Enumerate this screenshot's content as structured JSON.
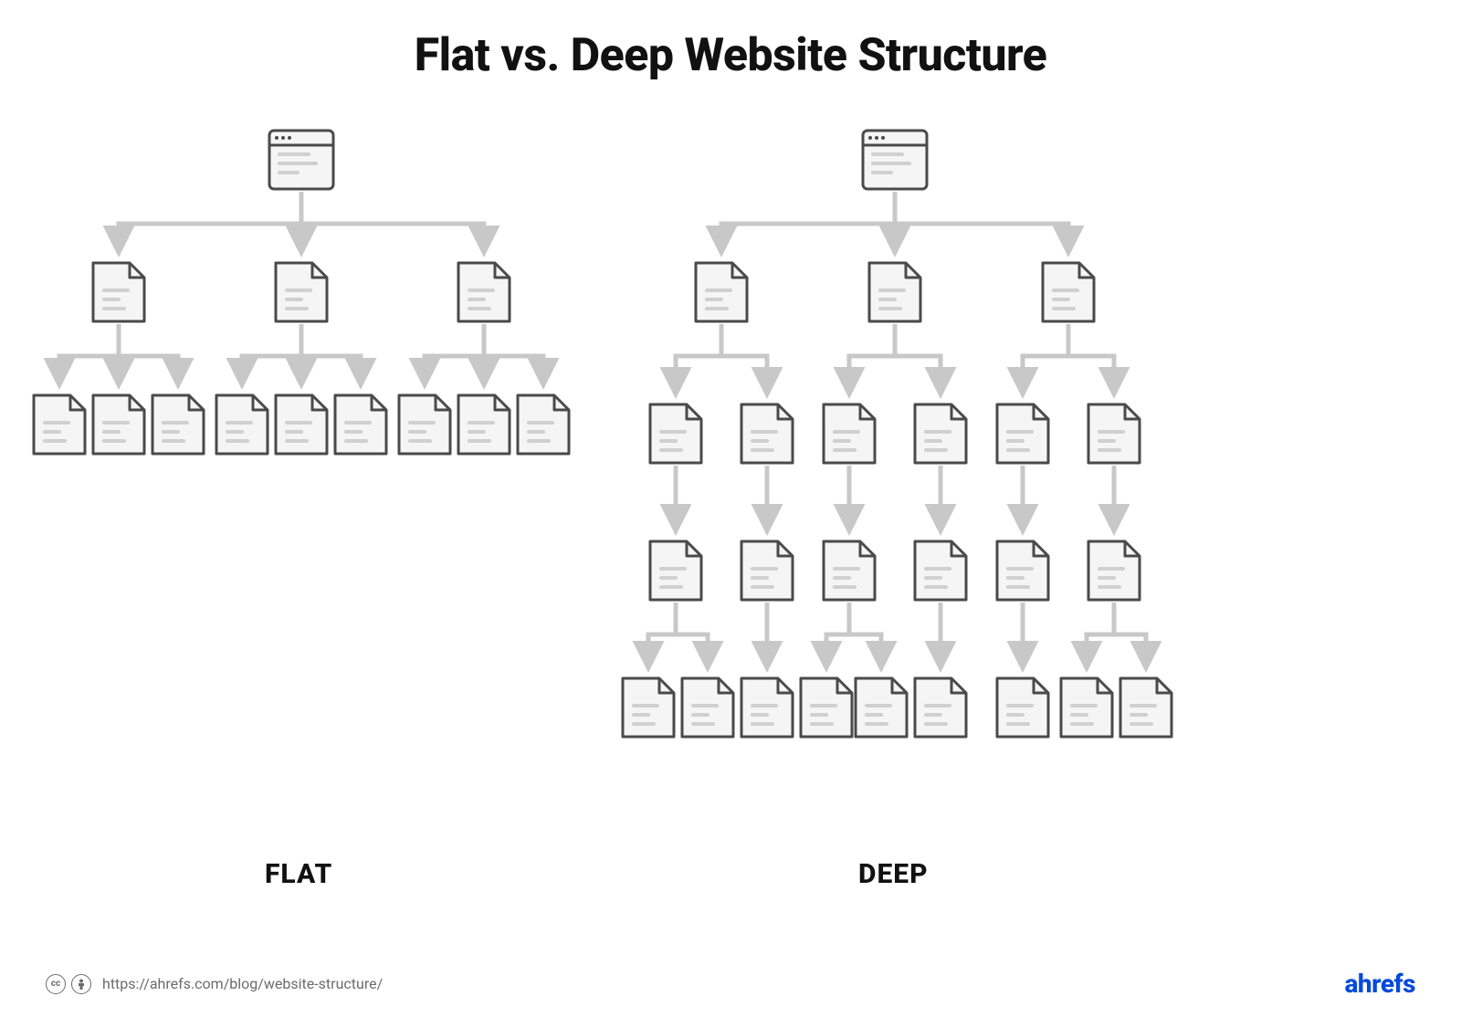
{
  "title": "Flat vs. Deep Website Structure",
  "labels": {
    "flat": "FLAT",
    "deep": "DEEP"
  },
  "footer": {
    "license_text": "https://ahrefs.com/blog/website-structure/",
    "brand": "ahrefs",
    "cc_label": "cc",
    "by_label": "BY"
  },
  "diagram": {
    "flat": {
      "root": {
        "type": "browser"
      },
      "level1_count": 3,
      "level2_per_node": 3,
      "depth": 3
    },
    "deep": {
      "root": {
        "type": "browser"
      },
      "level1_count": 3,
      "level2_per_node": 2,
      "level3_per_node": 1,
      "level4_groups": [
        2,
        1,
        2,
        1,
        1,
        2
      ],
      "depth": 5
    }
  },
  "colors": {
    "icon_stroke": "#4a4a4a",
    "icon_fill_bg": "#f5f5f5",
    "icon_line_fill": "#d0d0d0",
    "connector": "#c8c8c8",
    "brand_blue": "#054ADA",
    "brand_orange": "#f06a0a"
  }
}
